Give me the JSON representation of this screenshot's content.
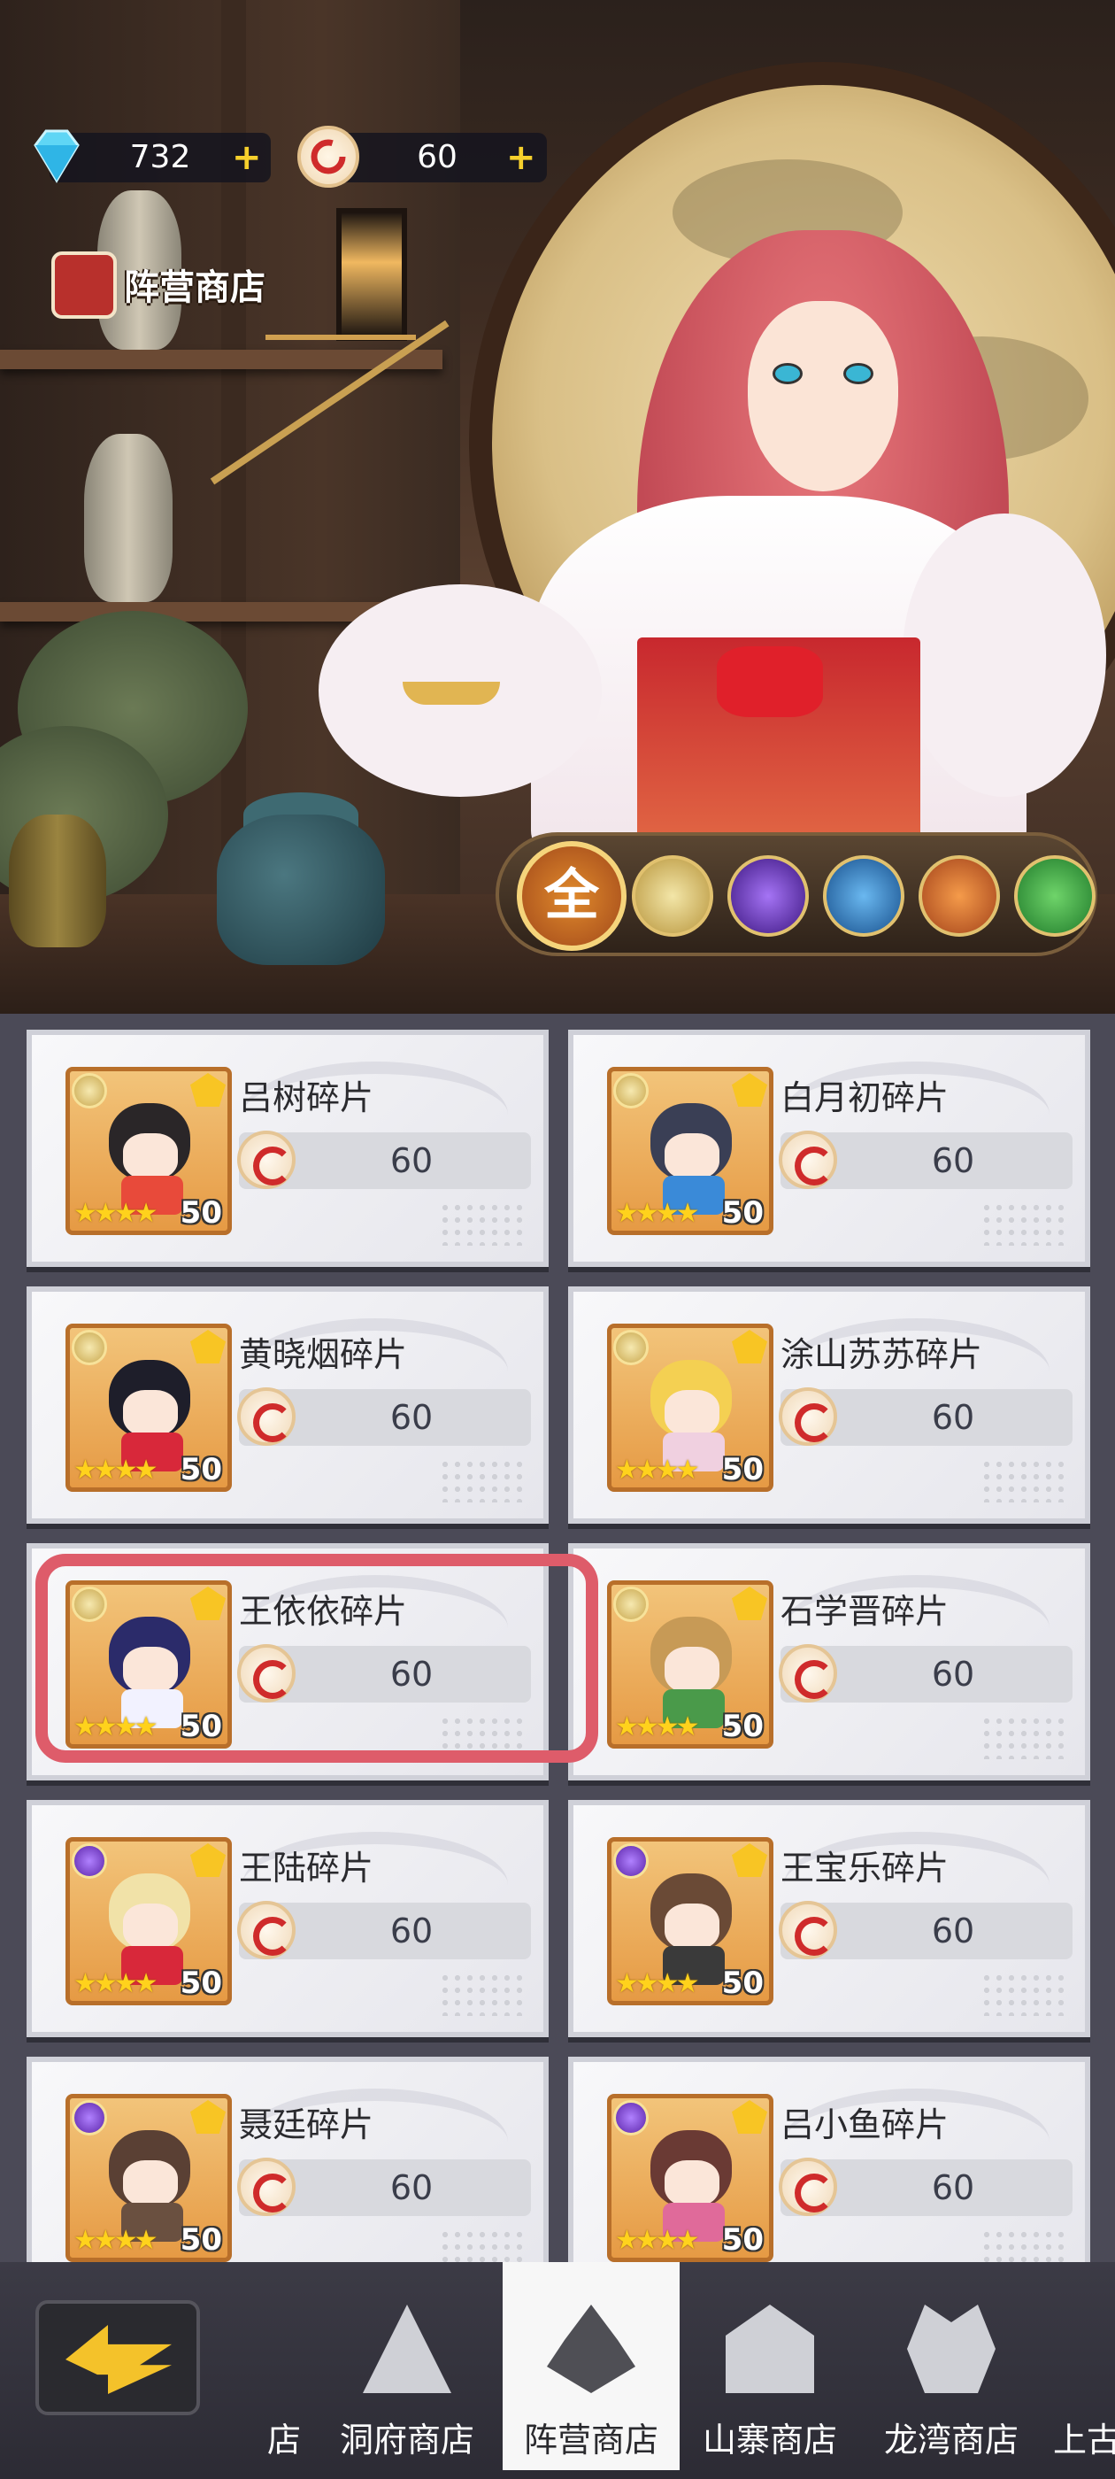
{
  "currency": {
    "gems": "732",
    "tokens": "60",
    "gem_icon": "diamond-icon",
    "token_icon": "dragon-coin-icon"
  },
  "shop": {
    "title": "阵营商店"
  },
  "faction_filter": {
    "all_label": "全",
    "buttons": [
      "lotus-icon",
      "purple-flame-icon",
      "yinyang-icon",
      "meditation-icon",
      "dna-icon"
    ]
  },
  "items": [
    {
      "name": "吕树碎片",
      "price": "60",
      "level": "50",
      "faction": "light"
    },
    {
      "name": "白月初碎片",
      "price": "60",
      "level": "50",
      "faction": "light"
    },
    {
      "name": "黄晓烟碎片",
      "price": "60",
      "level": "50",
      "faction": "light"
    },
    {
      "name": "涂山苏苏碎片",
      "price": "60",
      "level": "50",
      "faction": "light"
    },
    {
      "name": "王依依碎片",
      "price": "60",
      "level": "50",
      "faction": "light"
    },
    {
      "name": "石学晋碎片",
      "price": "60",
      "level": "50",
      "faction": "light"
    },
    {
      "name": "王陆碎片",
      "price": "60",
      "level": "50",
      "faction": "purple"
    },
    {
      "name": "王宝乐碎片",
      "price": "60",
      "level": "50",
      "faction": "purple"
    },
    {
      "name": "聂廷碎片",
      "price": "60",
      "level": "50",
      "faction": "purple"
    },
    {
      "name": "吕小鱼碎片",
      "price": "60",
      "level": "50",
      "faction": "purple"
    }
  ],
  "stars": "★★★★",
  "nav": {
    "partial_left": "店",
    "tabs": [
      "洞府商店",
      "阵营商店",
      "山寨商店",
      "龙湾商店"
    ],
    "partial_right": "上古",
    "active": "阵营商店"
  },
  "colors": {
    "highlight": "#de5c6a",
    "accent_gold": "#f4c22a",
    "price_pill": "#d8d9de"
  }
}
